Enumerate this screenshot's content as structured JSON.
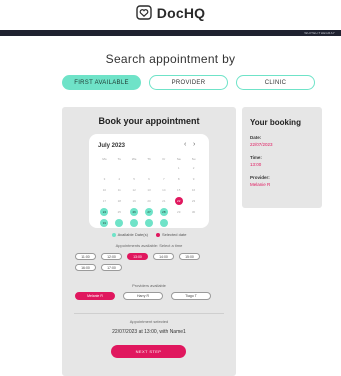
{
  "brand": {
    "name": "DocHQ"
  },
  "top_bar": {
    "text": "WHITELITHEGRAY"
  },
  "heading": "Search appointment by",
  "tabs": [
    {
      "label": "FIRST AVAILABLE",
      "active": true
    },
    {
      "label": "PROVIDER",
      "active": false
    },
    {
      "label": "CLINIC",
      "active": false
    }
  ],
  "booking_form": {
    "title": "Book your appointment",
    "calendar": {
      "month": "July 2023",
      "weekdays": [
        "Mo",
        "Tu",
        "We",
        "Th",
        "Fr",
        "Sa",
        "Su"
      ],
      "days": [
        {
          "day": "",
          "state": "empty"
        },
        {
          "day": "",
          "state": "empty"
        },
        {
          "day": "",
          "state": "empty"
        },
        {
          "day": "",
          "state": "empty"
        },
        {
          "day": "",
          "state": "empty"
        },
        {
          "day": "1",
          "state": "muted"
        },
        {
          "day": "2",
          "state": "muted"
        },
        {
          "day": "3",
          "state": "muted"
        },
        {
          "day": "4",
          "state": "muted"
        },
        {
          "day": "5",
          "state": "muted"
        },
        {
          "day": "6",
          "state": "muted"
        },
        {
          "day": "7",
          "state": "muted"
        },
        {
          "day": "8",
          "state": "muted"
        },
        {
          "day": "9",
          "state": "muted"
        },
        {
          "day": "10",
          "state": "muted"
        },
        {
          "day": "11",
          "state": "muted"
        },
        {
          "day": "12",
          "state": "muted"
        },
        {
          "day": "13",
          "state": "muted"
        },
        {
          "day": "14",
          "state": "muted"
        },
        {
          "day": "15",
          "state": "muted"
        },
        {
          "day": "16",
          "state": "muted"
        },
        {
          "day": "17",
          "state": "muted"
        },
        {
          "day": "18",
          "state": "muted"
        },
        {
          "day": "19",
          "state": "muted"
        },
        {
          "day": "20",
          "state": "muted"
        },
        {
          "day": "21",
          "state": "muted"
        },
        {
          "day": "22",
          "state": "selected"
        },
        {
          "day": "23",
          "state": "muted"
        },
        {
          "day": "24",
          "state": "available"
        },
        {
          "day": "25",
          "state": "muted"
        },
        {
          "day": "26",
          "state": "available"
        },
        {
          "day": "27",
          "state": "available"
        },
        {
          "day": "28",
          "state": "available"
        },
        {
          "day": "29",
          "state": "muted"
        },
        {
          "day": "30",
          "state": "muted"
        },
        {
          "day": "31",
          "state": "available"
        },
        {
          "day": "",
          "state": "available"
        },
        {
          "day": "",
          "state": "available"
        },
        {
          "day": "",
          "state": "available"
        },
        {
          "day": "",
          "state": "available"
        },
        {
          "day": "",
          "state": "muted"
        },
        {
          "day": "",
          "state": "muted"
        }
      ]
    },
    "legend": {
      "available": "Available Date(s)",
      "selected": "Selected date"
    },
    "times_label": "Appointments available: Select a time",
    "times": [
      {
        "label": "11:00",
        "active": false
      },
      {
        "label": "12:00",
        "active": false
      },
      {
        "label": "13:00",
        "active": true
      },
      {
        "label": "14:00",
        "active": false
      },
      {
        "label": "15:00",
        "active": false
      },
      {
        "label": "16:00",
        "active": false
      },
      {
        "label": "17:00",
        "active": false
      }
    ],
    "providers_label": "Providers available",
    "providers": [
      {
        "label": "Melanie R",
        "active": true
      },
      {
        "label": "Harry R",
        "active": false
      },
      {
        "label": "Tiago T",
        "active": false
      }
    ],
    "appointment_selected_label": "Appointment selected",
    "appointment_detail": "22/07/2023 at 13:00, with Name1",
    "next_button": "NEXT STEP"
  },
  "your_booking": {
    "title": "Your booking",
    "date_label": "Date:",
    "date_value": "22/07/2023",
    "time_label": "Time:",
    "time_value": "13:00",
    "provider_label": "Provider:",
    "provider_value": "Melanie R"
  },
  "colors": {
    "accent": "#6fe3c8",
    "brand_pink": "#e0175e",
    "dark_bar": "#1f2230",
    "card_bg": "#e6e6e6"
  }
}
